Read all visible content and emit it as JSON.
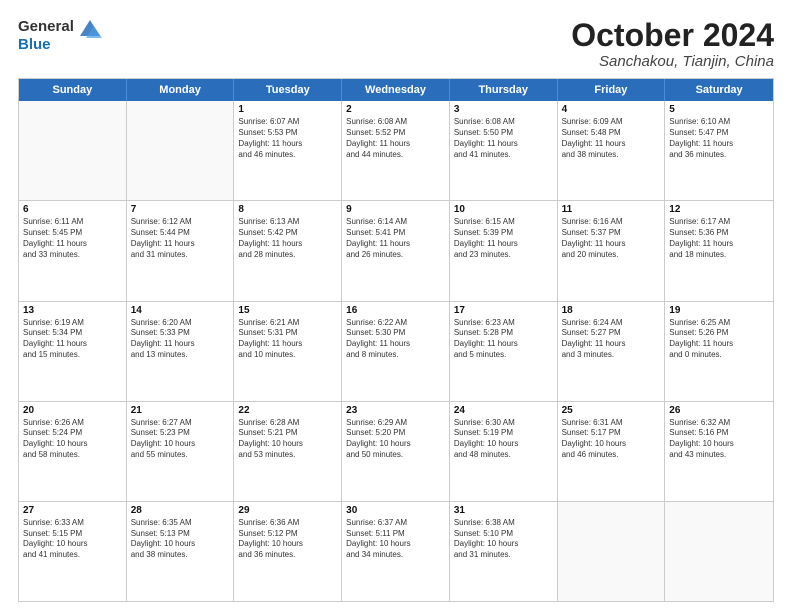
{
  "logo": {
    "line1": "General",
    "line2": "Blue"
  },
  "header": {
    "month": "October 2024",
    "location": "Sanchakou, Tianjin, China"
  },
  "weekdays": [
    "Sunday",
    "Monday",
    "Tuesday",
    "Wednesday",
    "Thursday",
    "Friday",
    "Saturday"
  ],
  "weeks": [
    [
      {
        "day": "",
        "lines": []
      },
      {
        "day": "",
        "lines": []
      },
      {
        "day": "1",
        "lines": [
          "Sunrise: 6:07 AM",
          "Sunset: 5:53 PM",
          "Daylight: 11 hours",
          "and 46 minutes."
        ]
      },
      {
        "day": "2",
        "lines": [
          "Sunrise: 6:08 AM",
          "Sunset: 5:52 PM",
          "Daylight: 11 hours",
          "and 44 minutes."
        ]
      },
      {
        "day": "3",
        "lines": [
          "Sunrise: 6:08 AM",
          "Sunset: 5:50 PM",
          "Daylight: 11 hours",
          "and 41 minutes."
        ]
      },
      {
        "day": "4",
        "lines": [
          "Sunrise: 6:09 AM",
          "Sunset: 5:48 PM",
          "Daylight: 11 hours",
          "and 38 minutes."
        ]
      },
      {
        "day": "5",
        "lines": [
          "Sunrise: 6:10 AM",
          "Sunset: 5:47 PM",
          "Daylight: 11 hours",
          "and 36 minutes."
        ]
      }
    ],
    [
      {
        "day": "6",
        "lines": [
          "Sunrise: 6:11 AM",
          "Sunset: 5:45 PM",
          "Daylight: 11 hours",
          "and 33 minutes."
        ]
      },
      {
        "day": "7",
        "lines": [
          "Sunrise: 6:12 AM",
          "Sunset: 5:44 PM",
          "Daylight: 11 hours",
          "and 31 minutes."
        ]
      },
      {
        "day": "8",
        "lines": [
          "Sunrise: 6:13 AM",
          "Sunset: 5:42 PM",
          "Daylight: 11 hours",
          "and 28 minutes."
        ]
      },
      {
        "day": "9",
        "lines": [
          "Sunrise: 6:14 AM",
          "Sunset: 5:41 PM",
          "Daylight: 11 hours",
          "and 26 minutes."
        ]
      },
      {
        "day": "10",
        "lines": [
          "Sunrise: 6:15 AM",
          "Sunset: 5:39 PM",
          "Daylight: 11 hours",
          "and 23 minutes."
        ]
      },
      {
        "day": "11",
        "lines": [
          "Sunrise: 6:16 AM",
          "Sunset: 5:37 PM",
          "Daylight: 11 hours",
          "and 20 minutes."
        ]
      },
      {
        "day": "12",
        "lines": [
          "Sunrise: 6:17 AM",
          "Sunset: 5:36 PM",
          "Daylight: 11 hours",
          "and 18 minutes."
        ]
      }
    ],
    [
      {
        "day": "13",
        "lines": [
          "Sunrise: 6:19 AM",
          "Sunset: 5:34 PM",
          "Daylight: 11 hours",
          "and 15 minutes."
        ]
      },
      {
        "day": "14",
        "lines": [
          "Sunrise: 6:20 AM",
          "Sunset: 5:33 PM",
          "Daylight: 11 hours",
          "and 13 minutes."
        ]
      },
      {
        "day": "15",
        "lines": [
          "Sunrise: 6:21 AM",
          "Sunset: 5:31 PM",
          "Daylight: 11 hours",
          "and 10 minutes."
        ]
      },
      {
        "day": "16",
        "lines": [
          "Sunrise: 6:22 AM",
          "Sunset: 5:30 PM",
          "Daylight: 11 hours",
          "and 8 minutes."
        ]
      },
      {
        "day": "17",
        "lines": [
          "Sunrise: 6:23 AM",
          "Sunset: 5:28 PM",
          "Daylight: 11 hours",
          "and 5 minutes."
        ]
      },
      {
        "day": "18",
        "lines": [
          "Sunrise: 6:24 AM",
          "Sunset: 5:27 PM",
          "Daylight: 11 hours",
          "and 3 minutes."
        ]
      },
      {
        "day": "19",
        "lines": [
          "Sunrise: 6:25 AM",
          "Sunset: 5:26 PM",
          "Daylight: 11 hours",
          "and 0 minutes."
        ]
      }
    ],
    [
      {
        "day": "20",
        "lines": [
          "Sunrise: 6:26 AM",
          "Sunset: 5:24 PM",
          "Daylight: 10 hours",
          "and 58 minutes."
        ]
      },
      {
        "day": "21",
        "lines": [
          "Sunrise: 6:27 AM",
          "Sunset: 5:23 PM",
          "Daylight: 10 hours",
          "and 55 minutes."
        ]
      },
      {
        "day": "22",
        "lines": [
          "Sunrise: 6:28 AM",
          "Sunset: 5:21 PM",
          "Daylight: 10 hours",
          "and 53 minutes."
        ]
      },
      {
        "day": "23",
        "lines": [
          "Sunrise: 6:29 AM",
          "Sunset: 5:20 PM",
          "Daylight: 10 hours",
          "and 50 minutes."
        ]
      },
      {
        "day": "24",
        "lines": [
          "Sunrise: 6:30 AM",
          "Sunset: 5:19 PM",
          "Daylight: 10 hours",
          "and 48 minutes."
        ]
      },
      {
        "day": "25",
        "lines": [
          "Sunrise: 6:31 AM",
          "Sunset: 5:17 PM",
          "Daylight: 10 hours",
          "and 46 minutes."
        ]
      },
      {
        "day": "26",
        "lines": [
          "Sunrise: 6:32 AM",
          "Sunset: 5:16 PM",
          "Daylight: 10 hours",
          "and 43 minutes."
        ]
      }
    ],
    [
      {
        "day": "27",
        "lines": [
          "Sunrise: 6:33 AM",
          "Sunset: 5:15 PM",
          "Daylight: 10 hours",
          "and 41 minutes."
        ]
      },
      {
        "day": "28",
        "lines": [
          "Sunrise: 6:35 AM",
          "Sunset: 5:13 PM",
          "Daylight: 10 hours",
          "and 38 minutes."
        ]
      },
      {
        "day": "29",
        "lines": [
          "Sunrise: 6:36 AM",
          "Sunset: 5:12 PM",
          "Daylight: 10 hours",
          "and 36 minutes."
        ]
      },
      {
        "day": "30",
        "lines": [
          "Sunrise: 6:37 AM",
          "Sunset: 5:11 PM",
          "Daylight: 10 hours",
          "and 34 minutes."
        ]
      },
      {
        "day": "31",
        "lines": [
          "Sunrise: 6:38 AM",
          "Sunset: 5:10 PM",
          "Daylight: 10 hours",
          "and 31 minutes."
        ]
      },
      {
        "day": "",
        "lines": []
      },
      {
        "day": "",
        "lines": []
      }
    ]
  ]
}
